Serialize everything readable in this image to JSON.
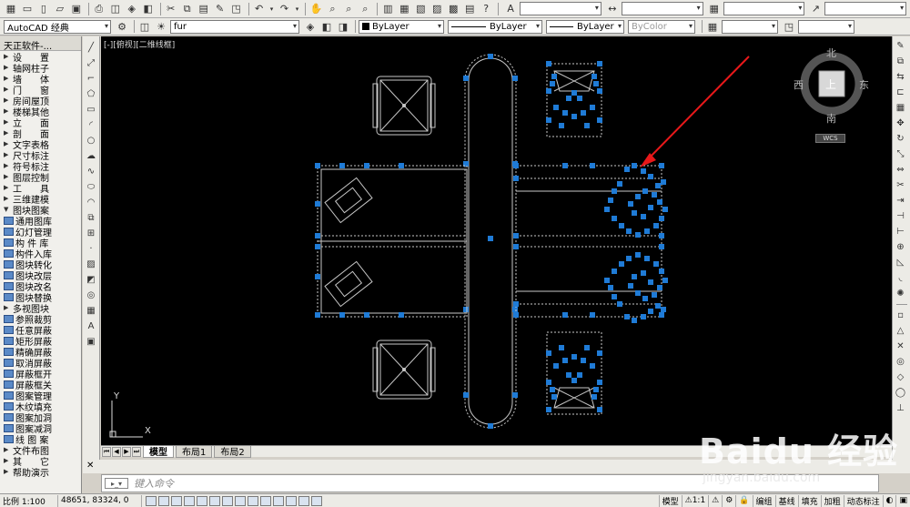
{
  "toolbar_top": {
    "icons": [
      "grid-icon",
      "folder-icon",
      "new-file-icon",
      "open-icon",
      "save-icon",
      "print-icon",
      "preview-icon",
      "publish-icon",
      "cut-icon",
      "copy-icon",
      "paste-icon",
      "match-icon",
      "undo-icon",
      "redo-icon",
      "pan-icon",
      "zoom-realtime-icon",
      "zoom-window-icon",
      "zoom-previous-icon",
      "properties-icon",
      "design-center-icon",
      "tool-palette-icon",
      "sheet-set-icon",
      "markup-icon",
      "calculator-icon",
      "help-icon"
    ]
  },
  "toolbar_second": {
    "workspace": "AutoCAD 经典",
    "layer": "fur",
    "color": "ByLayer",
    "linetype": "ByLayer",
    "lineweight": "ByLayer",
    "plotstyle": "ByColor"
  },
  "palette": {
    "title": "天正软件-...",
    "items": [
      {
        "label": "设　　置",
        "kind": "menu"
      },
      {
        "label": "轴网柱子",
        "kind": "menu"
      },
      {
        "label": "墙　　体",
        "kind": "menu"
      },
      {
        "label": "门　　窗",
        "kind": "menu"
      },
      {
        "label": "房间屋顶",
        "kind": "menu"
      },
      {
        "label": "楼梯其他",
        "kind": "menu"
      },
      {
        "label": "立　　面",
        "kind": "menu"
      },
      {
        "label": "剖　　面",
        "kind": "menu"
      },
      {
        "label": "文字表格",
        "kind": "menu"
      },
      {
        "label": "尺寸标注",
        "kind": "menu"
      },
      {
        "label": "符号标注",
        "kind": "menu"
      },
      {
        "label": "图层控制",
        "kind": "menu"
      },
      {
        "label": "工　　具",
        "kind": "menu"
      },
      {
        "label": "三维建模",
        "kind": "menu"
      },
      {
        "label": "图块图案",
        "kind": "open"
      },
      {
        "label": "通用图库",
        "kind": "cmd"
      },
      {
        "label": "幻灯管理",
        "kind": "cmd"
      },
      {
        "label": "构 件 库",
        "kind": "cmd"
      },
      {
        "label": "构件入库",
        "kind": "cmd"
      },
      {
        "label": "图块转化",
        "kind": "cmd"
      },
      {
        "label": "图块改层",
        "kind": "cmd"
      },
      {
        "label": "图块改名",
        "kind": "cmd"
      },
      {
        "label": "图块替换",
        "kind": "cmd"
      },
      {
        "label": "多视图块",
        "kind": "menu"
      },
      {
        "label": "参照裁剪",
        "kind": "cmd"
      },
      {
        "label": "任意屏蔽",
        "kind": "cmd"
      },
      {
        "label": "矩形屏蔽",
        "kind": "cmd"
      },
      {
        "label": "精确屏蔽",
        "kind": "cmd"
      },
      {
        "label": "取消屏蔽",
        "kind": "cmd"
      },
      {
        "label": "屏蔽框开",
        "kind": "cmd"
      },
      {
        "label": "屏蔽框关",
        "kind": "cmd"
      },
      {
        "label": "图案管理",
        "kind": "cmd"
      },
      {
        "label": "木纹填充",
        "kind": "cmd"
      },
      {
        "label": "图案加洞",
        "kind": "cmd"
      },
      {
        "label": "图案减洞",
        "kind": "cmd"
      },
      {
        "label": "线 图 案",
        "kind": "cmd"
      },
      {
        "label": "文件布图",
        "kind": "menu"
      },
      {
        "label": "其　　它",
        "kind": "menu"
      },
      {
        "label": "帮助演示",
        "kind": "menu"
      }
    ]
  },
  "viewport": {
    "label": "[-][俯视][二维线框]"
  },
  "viewcube": {
    "north": "北",
    "south": "南",
    "east": "东",
    "west": "西",
    "top": "上",
    "wcs": "WCS"
  },
  "ucs": {
    "x": "X",
    "y": "Y"
  },
  "tabs": [
    "模型",
    "布局1",
    "布局2"
  ],
  "command": {
    "placeholder": "键入命令"
  },
  "status": {
    "scale": "比例 1:100",
    "coords": "48651, 83324, 0",
    "model": "模型",
    "annotation_scale": "1:1",
    "buttons": [
      "编组",
      "基线",
      "填充",
      "加粗",
      "动态标注"
    ]
  },
  "watermark": {
    "logo": "Baidu 经验",
    "url": "jingyan.baidu.com"
  },
  "colors": {
    "grip": "#1f7bd6",
    "arrow": "#e8181a",
    "line": "#c8c8c8"
  }
}
